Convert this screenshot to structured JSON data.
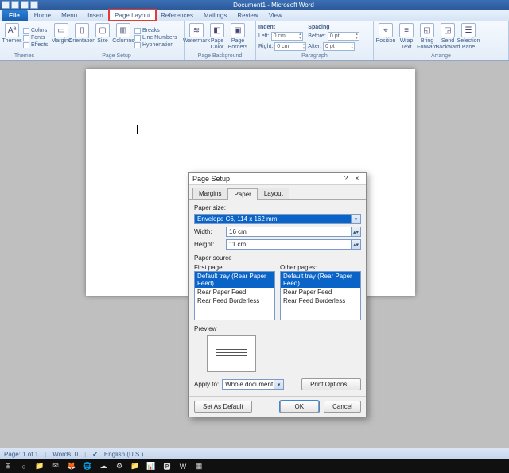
{
  "window_title": "Document1 - Microsoft Word",
  "tabs": [
    "File",
    "Home",
    "Menu",
    "Insert",
    "Page Layout",
    "References",
    "Mailings",
    "Review",
    "View"
  ],
  "active_tab": "Page Layout",
  "ribbon": {
    "themes": {
      "label": "Themes",
      "items": [
        "Colors",
        "Fonts",
        "Effects"
      ],
      "big": "Themes"
    },
    "page_setup": {
      "label": "Page Setup",
      "bigs": [
        "Margins",
        "Orientation",
        "Size",
        "Columns"
      ],
      "smalls": [
        "Breaks",
        "Line Numbers",
        "Hyphenation"
      ]
    },
    "page_bg": {
      "label": "Page Background",
      "bigs": [
        "Watermark",
        "Page Color",
        "Page Borders"
      ]
    },
    "paragraph": {
      "label": "Paragraph",
      "indent_label": "Indent",
      "spacing_label": "Spacing",
      "left_label": "Left:",
      "right_label": "Right:",
      "before_label": "Before:",
      "after_label": "After:",
      "left": "0 cm",
      "right": "0 cm",
      "before": "0 pt",
      "after": "0 pt"
    },
    "arrange": {
      "label": "Arrange",
      "bigs": [
        "Position",
        "Wrap Text",
        "Bring Forward",
        "Send Backward",
        "Selection Pane"
      ]
    }
  },
  "dialog": {
    "title": "Page Setup",
    "tabs": [
      "Margins",
      "Paper",
      "Layout"
    ],
    "active_tab": "Paper",
    "paper_size_label": "Paper size:",
    "paper_size_value": "Envelope C6, 114 x 162 mm",
    "width_label": "Width:",
    "width_value": "16 cm",
    "height_label": "Height:",
    "height_value": "11 cm",
    "paper_source_label": "Paper source",
    "first_page_label": "First page:",
    "other_pages_label": "Other pages:",
    "tray_options": [
      "Default tray (Rear Paper Feed)",
      "Rear Paper Feed",
      "Rear Feed Borderless"
    ],
    "preview_label": "Preview",
    "apply_to_label": "Apply to:",
    "apply_to_value": "Whole document",
    "print_options_btn": "Print Options...",
    "set_default_btn": "Set As Default",
    "ok_btn": "OK",
    "cancel_btn": "Cancel",
    "help": "?",
    "close": "×"
  },
  "status": {
    "page": "Page: 1 of 1",
    "words": "Words: 0",
    "lang": "English (U.S.)"
  },
  "taskbar_icons": [
    "⊞",
    "○",
    "📁",
    "✉",
    "🦊",
    "🌐",
    "☁",
    "⚙",
    "📁",
    "📊",
    "🅿",
    "W",
    "▦"
  ]
}
